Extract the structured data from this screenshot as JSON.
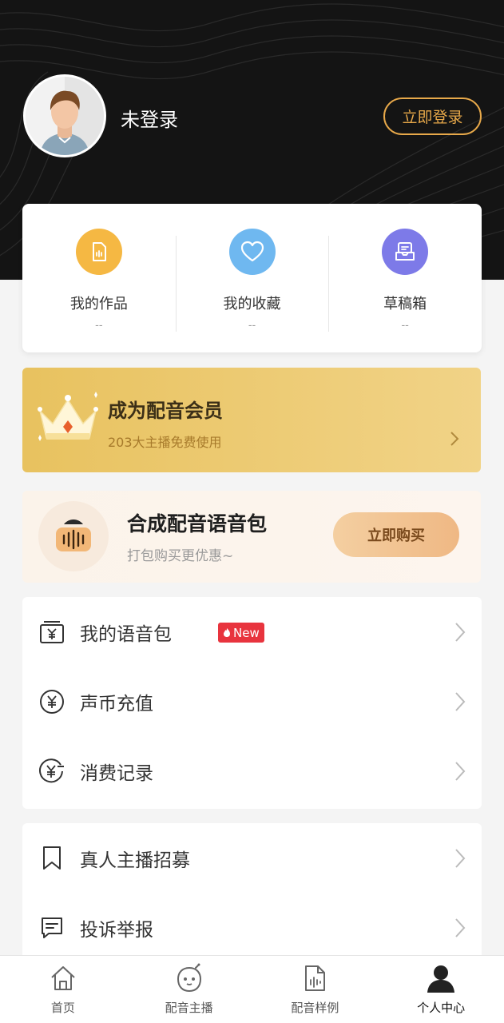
{
  "header": {
    "user_name": "未登录",
    "login_label": "立即登录"
  },
  "stats": [
    {
      "label": "我的作品",
      "count": "--",
      "icon": "document-audio-icon",
      "color": "#f5b843"
    },
    {
      "label": "我的收藏",
      "count": "--",
      "icon": "heart-icon",
      "color": "#6fb8f0"
    },
    {
      "label": "草稿箱",
      "count": "--",
      "icon": "inbox-icon",
      "color": "#7d7ae8"
    }
  ],
  "vip": {
    "title": "成为配音会员",
    "subtitle": "203大主播免费使用"
  },
  "voice_pack": {
    "title": "合成配音语音包",
    "subtitle": "打包购买更优惠~",
    "button_label": "立即购买"
  },
  "menu_group_1": [
    {
      "label": "我的语音包",
      "icon": "voice-pack-icon",
      "badge": "New"
    },
    {
      "label": "声币充值",
      "icon": "coin-icon"
    },
    {
      "label": "消费记录",
      "icon": "spending-record-icon"
    }
  ],
  "menu_group_2": [
    {
      "label": "真人主播招募",
      "icon": "bookmark-icon"
    },
    {
      "label": "投诉举报",
      "icon": "chat-report-icon"
    }
  ],
  "tabbar": [
    {
      "label": "首页",
      "icon": "home-icon"
    },
    {
      "label": "配音主播",
      "icon": "robot-face-icon"
    },
    {
      "label": "配音样例",
      "icon": "audio-file-icon"
    },
    {
      "label": "个人中心",
      "icon": "person-icon",
      "active": true
    }
  ],
  "colors": {
    "accent_gold": "#e8a94a",
    "badge_red": "#e8343e",
    "hero_bg": "#141414"
  }
}
